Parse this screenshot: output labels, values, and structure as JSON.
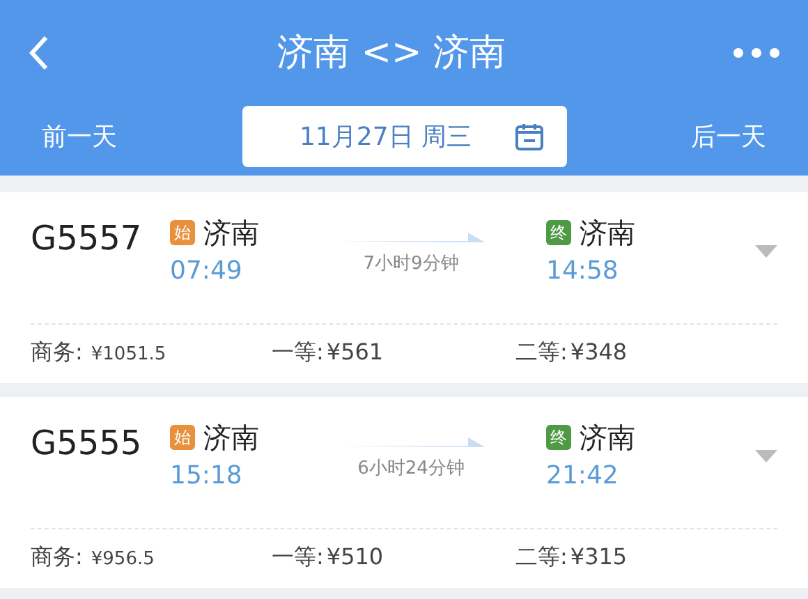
{
  "header": {
    "title": "济南 <> 济南",
    "prev_day": "前一天",
    "date": "11月27日 周三",
    "next_day": "后一天"
  },
  "trains": [
    {
      "number": "G5557",
      "from": {
        "badge": "始",
        "color": "#e8903c",
        "station": "济南",
        "time": "07:49"
      },
      "duration": "7小时9分钟",
      "to": {
        "badge": "终",
        "color": "#4f9a45",
        "station": "济南",
        "time": "14:58"
      },
      "prices": [
        {
          "label": "商务:",
          "price": "¥1051.5"
        },
        {
          "label": "一等:",
          "price": "¥561"
        },
        {
          "label": "二等:",
          "price": "¥348"
        }
      ]
    },
    {
      "number": "G5555",
      "from": {
        "badge": "始",
        "color": "#e8903c",
        "station": "济南",
        "time": "15:18"
      },
      "duration": "6小时24分钟",
      "to": {
        "badge": "终",
        "color": "#4f9a45",
        "station": "济南",
        "time": "21:42"
      },
      "prices": [
        {
          "label": "商务:",
          "price": "¥956.5"
        },
        {
          "label": "一等:",
          "price": "¥510"
        },
        {
          "label": "二等:",
          "price": "¥315"
        }
      ]
    }
  ]
}
